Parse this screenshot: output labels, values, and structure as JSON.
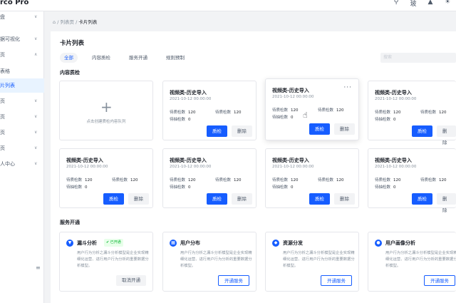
{
  "app": {
    "title": "rco Pro"
  },
  "topbar_icons": [
    "search-icon",
    "language-icon",
    "notification-icon",
    "theme-icon"
  ],
  "sidebar": {
    "items": [
      {
        "label": "盘",
        "expandable": true
      },
      {
        "label": "据可视化",
        "expandable": true
      },
      {
        "label": "页",
        "expandable": true
      },
      {
        "label": "表格",
        "expandable": false
      },
      {
        "label": "片列表",
        "expandable": false,
        "active": true
      },
      {
        "label": "页",
        "expandable": true
      },
      {
        "label": "页",
        "expandable": true
      },
      {
        "label": "页",
        "expandable": true
      },
      {
        "label": "页",
        "expandable": true
      },
      {
        "label": "人中心",
        "expandable": true
      }
    ]
  },
  "breadcrumb": {
    "root": "列表页",
    "sep": "/",
    "current": "卡片列表"
  },
  "page": {
    "title": "卡片列表"
  },
  "tabs": [
    {
      "label": "全部",
      "active": true
    },
    {
      "label": "内容质检",
      "active": false
    },
    {
      "label": "服务开通",
      "active": false
    },
    {
      "label": "规则预制",
      "active": false
    }
  ],
  "search": {
    "placeholder": "搜索"
  },
  "quality": {
    "section_title": "内容质检",
    "add_label": "点击创建质检内容队列",
    "card_title": "视频类-历史导入",
    "card_date": "2021-10-12 00:00:00",
    "pending_label": "待质检数",
    "pending_value": "120",
    "extract_label": "待抽检数",
    "extract_value": "0",
    "inspect_btn": "质检",
    "delete_btn": "删除"
  },
  "services": {
    "section_title": "服务开通",
    "desc": "用户行为分析之漏斗分析模型是企业实现精细化运营、进行用户行为分析的重要数据分析模型。",
    "open_btn": "开通服务",
    "cancel_btn": "取消开通",
    "items": [
      {
        "name": "漏斗分析",
        "badge": "已开通",
        "opened": true
      },
      {
        "name": "用户分布",
        "opened": false
      },
      {
        "name": "资源分发",
        "opened": false
      },
      {
        "name": "用户画像分析",
        "opened": false
      }
    ]
  },
  "colors": {
    "primary": "#165dff",
    "success": "#00b42a",
    "bg": "#f2f3f5"
  }
}
